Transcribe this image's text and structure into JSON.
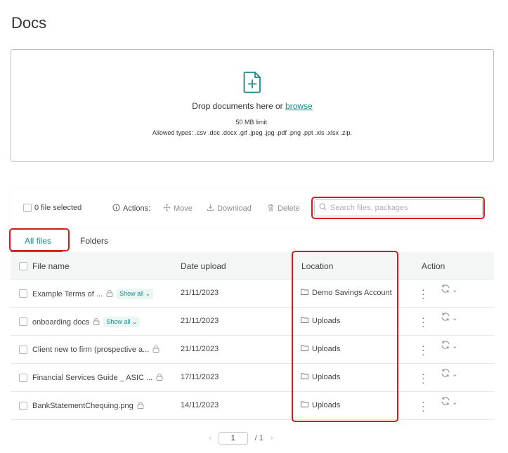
{
  "page": {
    "title": "Docs"
  },
  "upload": {
    "prompt": "Drop documents here or",
    "browse_label": "browse",
    "limit": "50 MB limit.",
    "allowed_types": "Allowed types: .csv .doc .docx .gif .jpeg .jpg .pdf .png .ppt .xls .xlsx .zip."
  },
  "toolbar": {
    "selected_label": "0 file selected",
    "actions_label": "Actions:",
    "move_label": "Move",
    "download_label": "Download",
    "delete_label": "Delete",
    "search_placeholder": "Search files, packages"
  },
  "tabs": [
    {
      "label": "All files",
      "active": true
    },
    {
      "label": "Folders",
      "active": false
    }
  ],
  "table": {
    "columns": [
      "File name",
      "Date upload",
      "Location",
      "Action"
    ],
    "show_all_label": "Show all",
    "rows": [
      {
        "name": "Example Terms of ...",
        "locked": true,
        "show_all": true,
        "date": "21/11/2023",
        "location": "Demo Savings Account"
      },
      {
        "name": "onboarding docs",
        "locked": true,
        "show_all": true,
        "date": "21/11/2023",
        "location": "Uploads"
      },
      {
        "name": "Client new to firm (prospective a...",
        "locked": true,
        "show_all": false,
        "date": "21/11/2023",
        "location": "Uploads"
      },
      {
        "name": "Financial Services Guide _ ASIC ...",
        "locked": true,
        "show_all": false,
        "date": "17/11/2023",
        "location": "Uploads"
      },
      {
        "name": "BankStatementChequing.png",
        "locked": true,
        "show_all": false,
        "date": "14/11/2023",
        "location": "Uploads"
      }
    ]
  },
  "pagination": {
    "current": "1",
    "total": "/ 1"
  },
  "colors": {
    "accent": "#1f8a8a",
    "highlight": "#d31c1c"
  }
}
